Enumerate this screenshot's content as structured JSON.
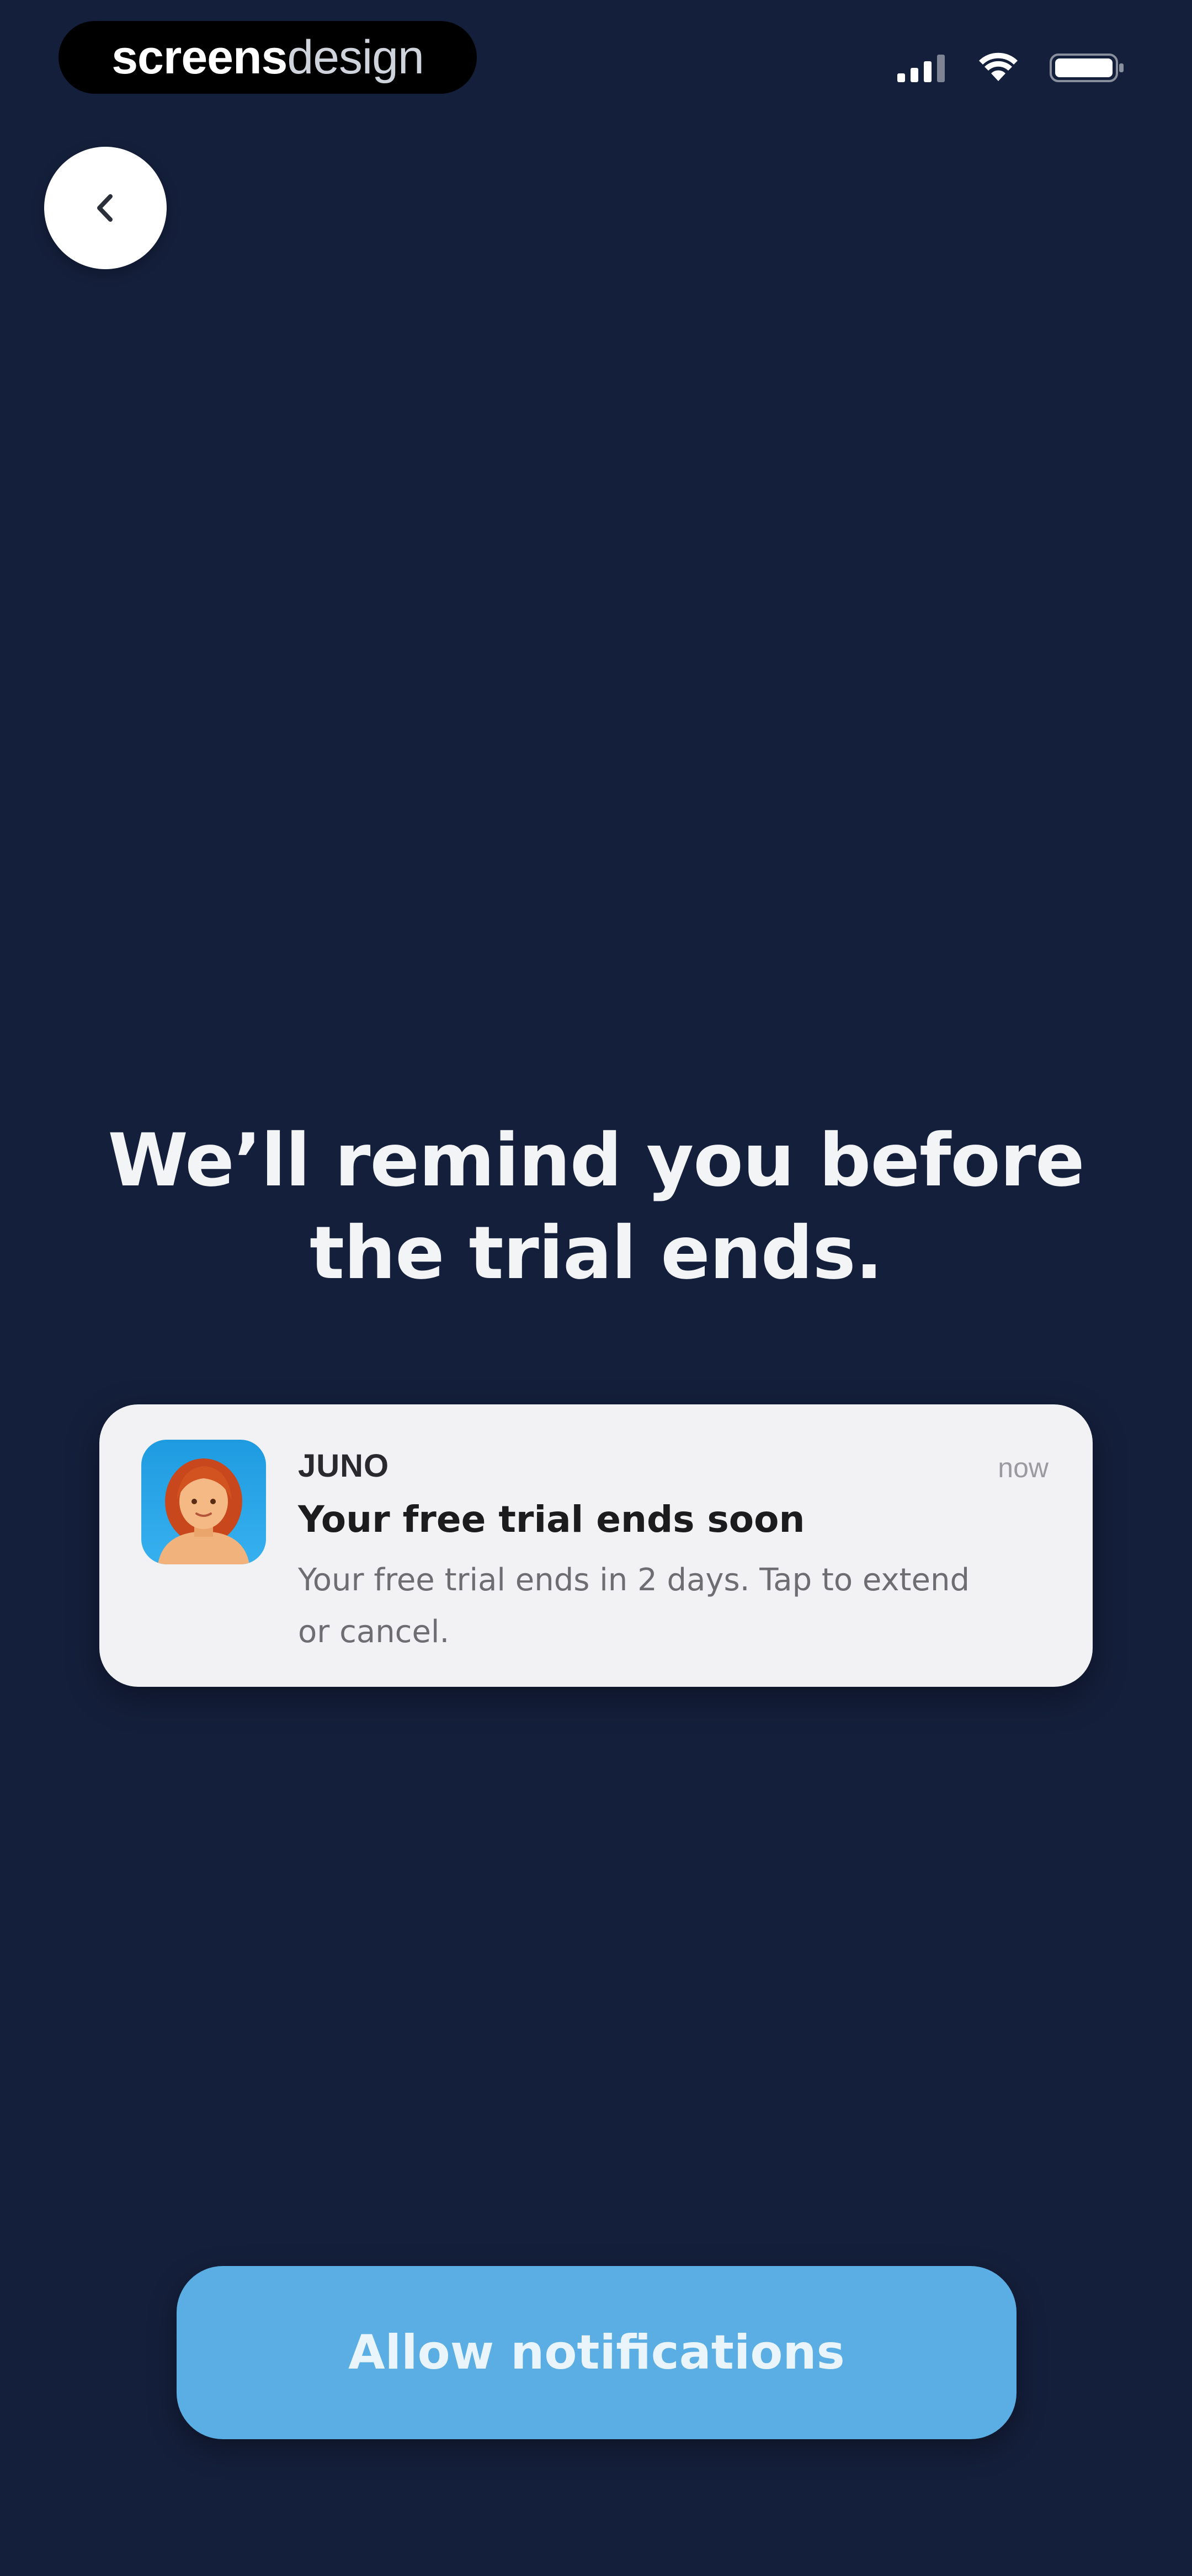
{
  "watermark": {
    "part_bold": "screens",
    "part_light": "design"
  },
  "status_bar": {
    "icons": [
      "signal-icon",
      "wifi-icon",
      "battery-icon"
    ]
  },
  "back_button": {
    "icon": "chevron-left-icon"
  },
  "heading": {
    "text": "We’ll remind you before the trial ends."
  },
  "notification": {
    "app_name": "JUNO",
    "time": "now",
    "title": "Your free trial ends soon",
    "body": "Your free trial ends in 2 days. Tap to extend or cancel.",
    "icon": "juno-app-icon"
  },
  "cta": {
    "label": "Allow notifications"
  },
  "colors": {
    "background": "#141f3b",
    "card": "#f2f2f5",
    "accent": "#5aaee3",
    "heading_text": "#f3f4f6"
  }
}
